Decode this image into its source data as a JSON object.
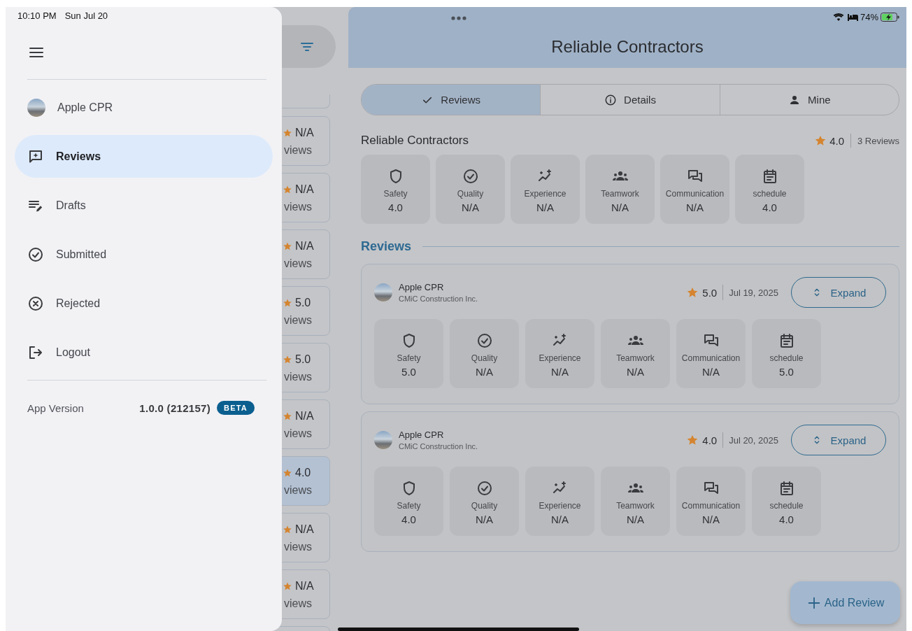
{
  "status_bar": {
    "time": "10:10 PM",
    "date": "Sun Jul 20",
    "battery": "74%"
  },
  "drawer": {
    "account": {
      "name": "Apple CPR"
    },
    "items": [
      {
        "label": "Reviews",
        "selected": true
      },
      {
        "label": "Drafts",
        "selected": false
      },
      {
        "label": "Submitted",
        "selected": false
      },
      {
        "label": "Rejected",
        "selected": false
      },
      {
        "label": "Logout",
        "selected": false
      }
    ],
    "app_version": {
      "label": "App Version",
      "value": "1.0.0 (212157)",
      "badge": "BETA"
    }
  },
  "contractor_list": [
    {
      "rating": "N/A",
      "reviews": "views",
      "selected": false
    },
    {
      "rating": "N/A",
      "reviews": "views",
      "selected": false
    },
    {
      "rating": "N/A",
      "reviews": "views",
      "selected": false
    },
    {
      "rating": "5.0",
      "reviews": "views",
      "selected": false
    },
    {
      "rating": "5.0",
      "reviews": "views",
      "selected": false
    },
    {
      "rating": "N/A",
      "reviews": "views",
      "selected": false
    },
    {
      "rating": "4.0",
      "reviews": "views",
      "selected": true
    },
    {
      "rating": "N/A",
      "reviews": "views",
      "selected": false
    },
    {
      "rating": "N/A",
      "reviews": "views",
      "selected": false
    }
  ],
  "header": {
    "title": "Reliable Contractors"
  },
  "tabs": [
    {
      "label": "Reviews",
      "selected": true
    },
    {
      "label": "Details",
      "selected": false
    },
    {
      "label": "Mine",
      "selected": false
    }
  ],
  "summary": {
    "name": "Reliable Contractors",
    "rating": "4.0",
    "count": "3 Reviews",
    "metrics": [
      {
        "label": "Safety",
        "value": "4.0"
      },
      {
        "label": "Quality",
        "value": "N/A"
      },
      {
        "label": "Experience",
        "value": "N/A"
      },
      {
        "label": "Teamwork",
        "value": "N/A"
      },
      {
        "label": "Communication",
        "value": "N/A"
      },
      {
        "label": "schedule",
        "value": "4.0"
      }
    ]
  },
  "reviews_heading": "Reviews",
  "reviews": [
    {
      "author": "Apple CPR",
      "company": "CMiC Construction Inc.",
      "rating": "5.0",
      "date": "Jul 19, 2025",
      "button": "Expand",
      "metrics": [
        {
          "label": "Safety",
          "value": "5.0"
        },
        {
          "label": "Quality",
          "value": "N/A"
        },
        {
          "label": "Experience",
          "value": "N/A"
        },
        {
          "label": "Teamwork",
          "value": "N/A"
        },
        {
          "label": "Communication",
          "value": "N/A"
        },
        {
          "label": "schedule",
          "value": "5.0"
        }
      ]
    },
    {
      "author": "Apple CPR",
      "company": "CMiC Construction Inc.",
      "rating": "4.0",
      "date": "Jul 20, 2025",
      "button": "Expand",
      "metrics": [
        {
          "label": "Safety",
          "value": "4.0"
        },
        {
          "label": "Quality",
          "value": "N/A"
        },
        {
          "label": "Experience",
          "value": "N/A"
        },
        {
          "label": "Teamwork",
          "value": "N/A"
        },
        {
          "label": "Communication",
          "value": "N/A"
        },
        {
          "label": "schedule",
          "value": "4.0"
        }
      ]
    }
  ],
  "fab": {
    "label": "Add Review"
  }
}
